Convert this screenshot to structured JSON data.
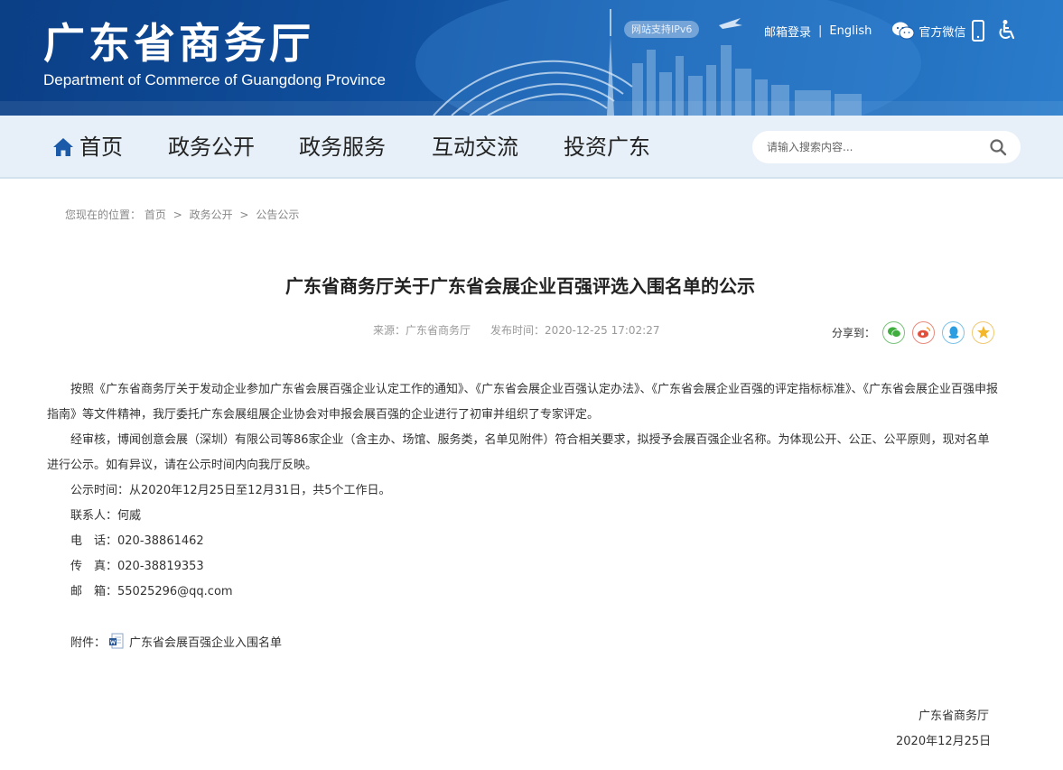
{
  "header": {
    "title_cn": "广东省商务厅",
    "title_en": "Department of Commerce of Guangdong Province",
    "ipv6_badge": "网站支持IPv6",
    "mail_login": "邮箱登录",
    "separator": "|",
    "english": "English",
    "wechat": "官方微信",
    "brand_color": "#0f4e9c"
  },
  "nav": {
    "items": [
      {
        "label": "首页"
      },
      {
        "label": "政务公开"
      },
      {
        "label": "政务服务"
      },
      {
        "label": "互动交流"
      },
      {
        "label": "投资广东"
      }
    ],
    "search_placeholder": "请输入搜索内容..."
  },
  "breadcrumb": {
    "prefix": "您现在的位置：",
    "items": [
      "首页",
      "政务公开",
      "公告公示"
    ],
    "separator": ">"
  },
  "article": {
    "title": "广东省商务厅关于广东省会展企业百强评选入围名单的公示",
    "source": "来源：广东省商务厅",
    "published": "发布时间：2020-12-25 17:02:27",
    "share_label": "分享到：",
    "paragraphs": [
      "按照《广东省商务厅关于发动企业参加广东省会展百强企业认定工作的通知》、《广东省会展企业百强认定办法》、《广东省会展企业百强的评定指标标准》、《广东省会展企业百强申报指南》等文件精神，我厅委托广东会展组展企业协会对申报会展百强的企业进行了初审并组织了专家评定。",
      "经审核，博闻创意会展（深圳）有限公司等86家企业（含主办、场馆、服务类，名单见附件）符合相关要求，拟授予会展百强企业名称。为体现公开、公正、公平原则，现对名单进行公示。如有异议，请在公示时间内向我厅反映。"
    ],
    "lines": [
      "公示时间：从2020年12月25日至12月31日，共5个工作日。",
      "联系人：何威",
      "电　话：020-38861462",
      "传　真：020-38819353",
      "邮　箱：55025296@qq.com"
    ],
    "attachment_label": "附件：",
    "attachment_name": "广东省会展百强企业入围名单",
    "sign_org": "广东省商务厅",
    "sign_date": "2020年12月25日"
  }
}
